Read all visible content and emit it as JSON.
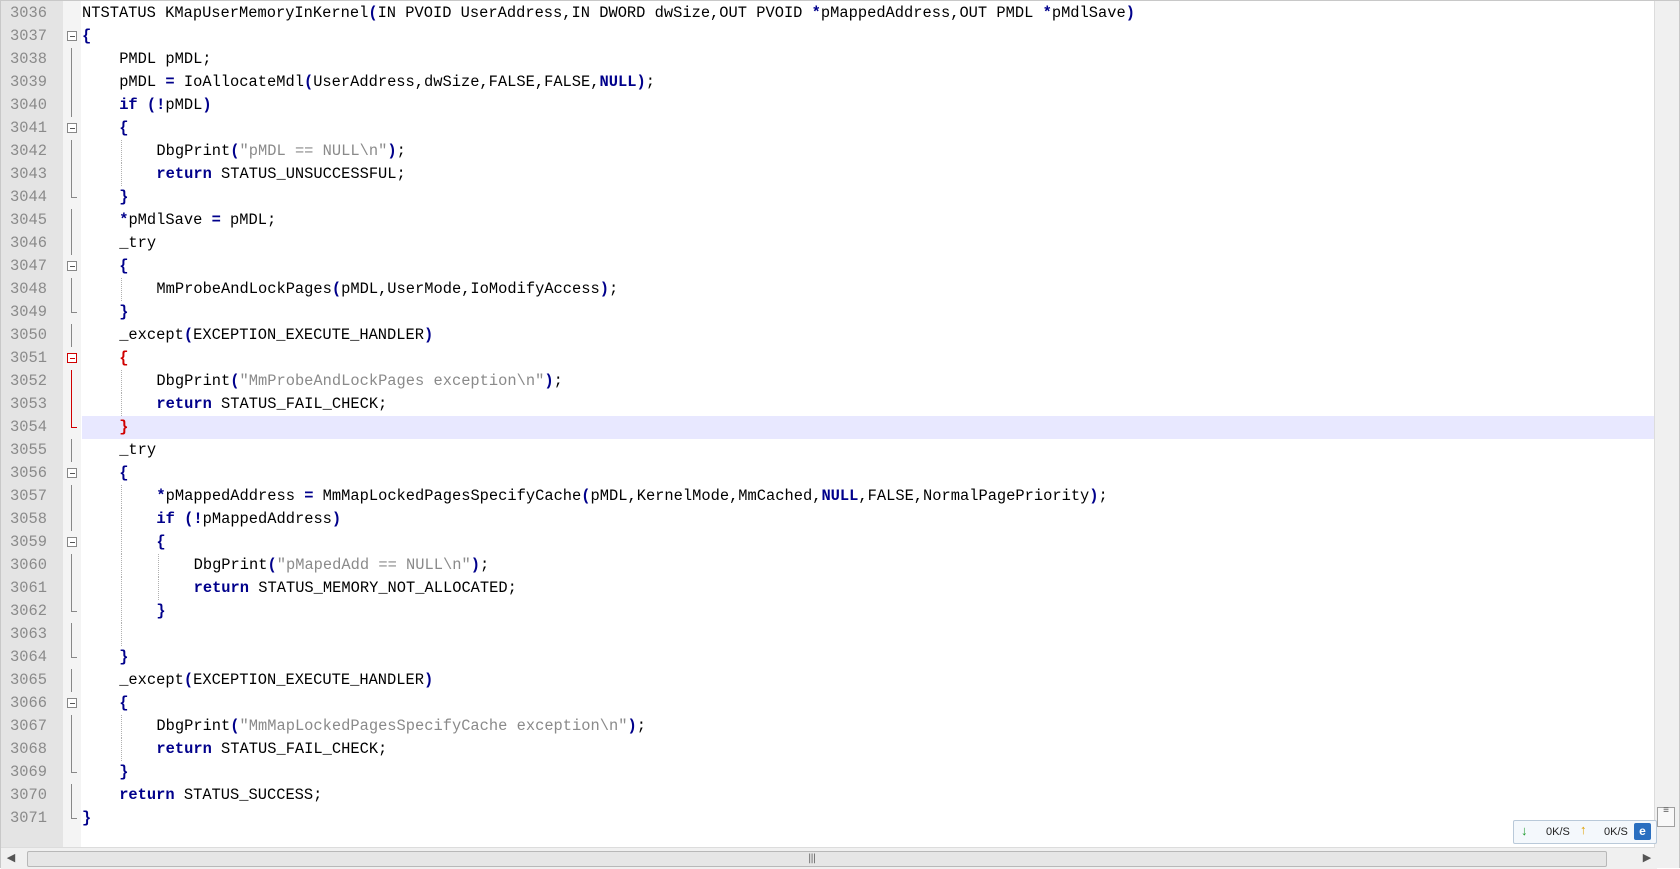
{
  "editor": {
    "lines": [
      {
        "n": "3036",
        "indent": 0,
        "tokens": [
          [
            "t",
            "NTSTATUS KMapUserMemoryInKernel"
          ],
          [
            "p",
            "("
          ],
          [
            "t",
            "IN PVOID UserAddress,IN DWORD dwSize,OUT PVOID "
          ],
          [
            "p",
            "*"
          ],
          [
            "t",
            "pMappedAddress,OUT PMDL "
          ],
          [
            "p",
            "*"
          ],
          [
            "t",
            "pMdlSave"
          ],
          [
            "p",
            ")"
          ]
        ],
        "fold": "none"
      },
      {
        "n": "3037",
        "indent": 0,
        "tokens": [
          [
            "p",
            "{"
          ]
        ],
        "fold": "open"
      },
      {
        "n": "3038",
        "indent": 1,
        "tokens": [
          [
            "t",
            "PMDL pMDL;"
          ]
        ],
        "fold": "line"
      },
      {
        "n": "3039",
        "indent": 1,
        "tokens": [
          [
            "t",
            "pMDL "
          ],
          [
            "p",
            "="
          ],
          [
            "t",
            " IoAllocateMdl"
          ],
          [
            "p",
            "("
          ],
          [
            "t",
            "UserAddress,dwSize,FALSE,FALSE,"
          ],
          [
            "k",
            "NULL"
          ],
          [
            "p",
            ")"
          ],
          [
            "t",
            ";"
          ]
        ],
        "fold": "line"
      },
      {
        "n": "3040",
        "indent": 1,
        "tokens": [
          [
            "k",
            "if"
          ],
          [
            "t",
            " "
          ],
          [
            "p",
            "(!"
          ],
          [
            "t",
            "pMDL"
          ],
          [
            "p",
            ")"
          ]
        ],
        "fold": "line"
      },
      {
        "n": "3041",
        "indent": 1,
        "tokens": [
          [
            "p",
            "{"
          ]
        ],
        "fold": "open"
      },
      {
        "n": "3042",
        "indent": 2,
        "tokens": [
          [
            "t",
            "DbgPrint"
          ],
          [
            "p",
            "("
          ],
          [
            "c",
            "\"pMDL == NULL\\n\""
          ],
          [
            "p",
            ")"
          ],
          [
            "t",
            ";"
          ]
        ],
        "fold": "line"
      },
      {
        "n": "3043",
        "indent": 2,
        "tokens": [
          [
            "k",
            "return"
          ],
          [
            "t",
            " STATUS_UNSUCCESSFUL;"
          ]
        ],
        "fold": "line"
      },
      {
        "n": "3044",
        "indent": 1,
        "tokens": [
          [
            "p",
            "}"
          ]
        ],
        "fold": "end"
      },
      {
        "n": "3045",
        "indent": 1,
        "tokens": [
          [
            "p",
            "*"
          ],
          [
            "t",
            "pMdlSave "
          ],
          [
            "p",
            "="
          ],
          [
            "t",
            " pMDL;"
          ]
        ],
        "fold": "line"
      },
      {
        "n": "3046",
        "indent": 1,
        "tokens": [
          [
            "t",
            "_try"
          ]
        ],
        "fold": "line"
      },
      {
        "n": "3047",
        "indent": 1,
        "tokens": [
          [
            "p",
            "{"
          ]
        ],
        "fold": "open"
      },
      {
        "n": "3048",
        "indent": 2,
        "tokens": [
          [
            "t",
            "MmProbeAndLockPages"
          ],
          [
            "p",
            "("
          ],
          [
            "t",
            "pMDL,UserMode,IoModifyAccess"
          ],
          [
            "p",
            ")"
          ],
          [
            "t",
            ";"
          ]
        ],
        "fold": "line"
      },
      {
        "n": "3049",
        "indent": 1,
        "tokens": [
          [
            "p",
            "}"
          ]
        ],
        "fold": "end"
      },
      {
        "n": "3050",
        "indent": 1,
        "tokens": [
          [
            "t",
            "_except"
          ],
          [
            "p",
            "("
          ],
          [
            "t",
            "EXCEPTION_EXECUTE_HANDLER"
          ],
          [
            "p",
            ")"
          ]
        ],
        "fold": "line"
      },
      {
        "n": "3051",
        "indent": 1,
        "tokens": [
          [
            "r",
            "{"
          ]
        ],
        "fold": "open-red"
      },
      {
        "n": "3052",
        "indent": 2,
        "tokens": [
          [
            "t",
            "DbgPrint"
          ],
          [
            "p",
            "("
          ],
          [
            "c",
            "\"MmProbeAndLockPages exception\\n\""
          ],
          [
            "p",
            ")"
          ],
          [
            "t",
            ";"
          ]
        ],
        "fold": "line-red"
      },
      {
        "n": "3053",
        "indent": 2,
        "tokens": [
          [
            "k",
            "return"
          ],
          [
            "t",
            " STATUS_FAIL_CHECK;"
          ]
        ],
        "fold": "line-red"
      },
      {
        "n": "3054",
        "indent": 1,
        "tokens": [
          [
            "r",
            "}"
          ]
        ],
        "fold": "end-red",
        "current": true
      },
      {
        "n": "3055",
        "indent": 1,
        "tokens": [
          [
            "t",
            "_try"
          ]
        ],
        "fold": "line"
      },
      {
        "n": "3056",
        "indent": 1,
        "tokens": [
          [
            "p",
            "{"
          ]
        ],
        "fold": "open"
      },
      {
        "n": "3057",
        "indent": 2,
        "tokens": [
          [
            "p",
            "*"
          ],
          [
            "t",
            "pMappedAddress "
          ],
          [
            "p",
            "="
          ],
          [
            "t",
            " MmMapLockedPagesSpecifyCache"
          ],
          [
            "p",
            "("
          ],
          [
            "t",
            "pMDL,KernelMode,MmCached,"
          ],
          [
            "k",
            "NULL"
          ],
          [
            "t",
            ",FALSE,NormalPagePriority"
          ],
          [
            "p",
            ")"
          ],
          [
            "t",
            ";"
          ]
        ],
        "fold": "line"
      },
      {
        "n": "3058",
        "indent": 2,
        "tokens": [
          [
            "k",
            "if"
          ],
          [
            "t",
            " "
          ],
          [
            "p",
            "(!"
          ],
          [
            "t",
            "pMappedAddress"
          ],
          [
            "p",
            ")"
          ]
        ],
        "fold": "line"
      },
      {
        "n": "3059",
        "indent": 2,
        "tokens": [
          [
            "p",
            "{"
          ]
        ],
        "fold": "open"
      },
      {
        "n": "3060",
        "indent": 3,
        "tokens": [
          [
            "t",
            "DbgPrint"
          ],
          [
            "p",
            "("
          ],
          [
            "c",
            "\"pMapedAdd == NULL\\n\""
          ],
          [
            "p",
            ")"
          ],
          [
            "t",
            ";"
          ]
        ],
        "fold": "line"
      },
      {
        "n": "3061",
        "indent": 3,
        "tokens": [
          [
            "k",
            "return"
          ],
          [
            "t",
            " STATUS_MEMORY_NOT_ALLOCATED;"
          ]
        ],
        "fold": "line"
      },
      {
        "n": "3062",
        "indent": 2,
        "tokens": [
          [
            "p",
            "}"
          ]
        ],
        "fold": "end"
      },
      {
        "n": "3063",
        "indent": 2,
        "tokens": [],
        "fold": "line"
      },
      {
        "n": "3064",
        "indent": 1,
        "tokens": [
          [
            "p",
            "}"
          ]
        ],
        "fold": "end"
      },
      {
        "n": "3065",
        "indent": 1,
        "tokens": [
          [
            "t",
            "_except"
          ],
          [
            "p",
            "("
          ],
          [
            "t",
            "EXCEPTION_EXECUTE_HANDLER"
          ],
          [
            "p",
            ")"
          ]
        ],
        "fold": "line"
      },
      {
        "n": "3066",
        "indent": 1,
        "tokens": [
          [
            "p",
            "{"
          ]
        ],
        "fold": "open"
      },
      {
        "n": "3067",
        "indent": 2,
        "tokens": [
          [
            "t",
            "DbgPrint"
          ],
          [
            "p",
            "("
          ],
          [
            "c",
            "\"MmMapLockedPagesSpecifyCache exception\\n\""
          ],
          [
            "p",
            ")"
          ],
          [
            "t",
            ";"
          ]
        ],
        "fold": "line"
      },
      {
        "n": "3068",
        "indent": 2,
        "tokens": [
          [
            "k",
            "return"
          ],
          [
            "t",
            " STATUS_FAIL_CHECK;"
          ]
        ],
        "fold": "line"
      },
      {
        "n": "3069",
        "indent": 1,
        "tokens": [
          [
            "p",
            "}"
          ]
        ],
        "fold": "end"
      },
      {
        "n": "3070",
        "indent": 1,
        "tokens": [
          [
            "k",
            "return"
          ],
          [
            "t",
            " STATUS_SUCCESS;"
          ]
        ],
        "fold": "line"
      },
      {
        "n": "3071",
        "indent": 0,
        "tokens": [
          [
            "p",
            "}"
          ]
        ],
        "fold": "end"
      }
    ]
  },
  "net_widget": {
    "download_rate": "0K/S",
    "upload_rate": "0K/S",
    "download_icon": "down-arrow-icon",
    "upload_icon": "up-arrow-icon",
    "browser_icon": "ie-icon"
  },
  "colors": {
    "keyword": "#00008b",
    "string": "#8a8a8a",
    "brace_match": "#d00000",
    "current_line": "#e8e8ff",
    "gutter": "#e4e4e4"
  }
}
